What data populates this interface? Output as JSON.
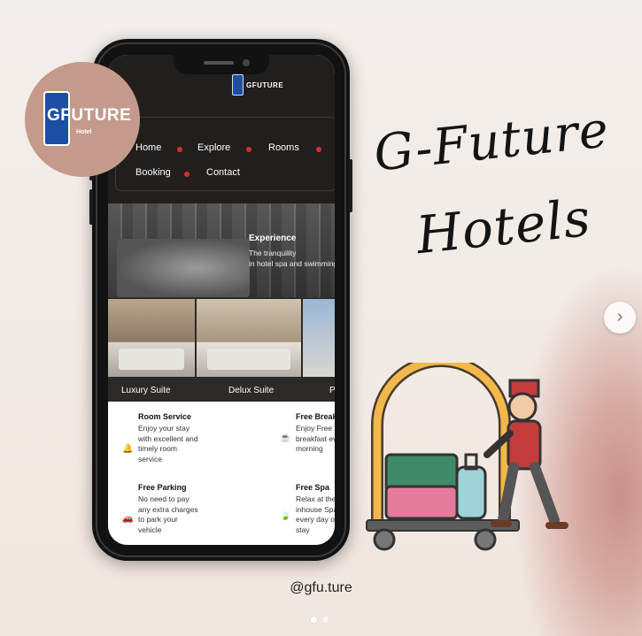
{
  "logo": {
    "title": "GFUTURE",
    "subtitle": "Hotel"
  },
  "headline": {
    "line1": "G-Future",
    "line2": "Hotels"
  },
  "phone_site": {
    "logo_text": "GFUTURE",
    "nav": [
      "Home",
      "Explore",
      "Rooms",
      "Booking",
      "Contact"
    ],
    "hero": {
      "title": "Experience",
      "line1": "The tranquility",
      "line2": "in hotel spa and swimming"
    },
    "rooms": [
      "Luxury Suite",
      "Delux Suite",
      "P"
    ],
    "services": [
      {
        "title": "Room Service",
        "desc": "Enjoy your stay\nwith excellent and\ntimely room\nservice",
        "icon": "bell-icon"
      },
      {
        "title": "Free Breakfast",
        "desc": "Enjoy Free\nbreakfast every\nmorning",
        "icon": "coffee-icon"
      },
      {
        "title": "Free Parking",
        "desc": "No need to pay\nany extra charges\nto park your\nvehicle",
        "icon": "car-icon"
      },
      {
        "title": "Free Spa",
        "desc": "Relax at the\ninhouse Spa\nevery day of\nstay",
        "icon": "leaf-icon"
      }
    ]
  },
  "handle": "@gfu.ture",
  "carousel": {
    "next_icon": "chevron-right-icon",
    "pages": 2,
    "current": 1
  },
  "colors": {
    "badge": "#c59a8c",
    "accent_red": "#d32f2f",
    "logo_blue": "#1d4ea5",
    "site_dark": "#211e1c"
  }
}
